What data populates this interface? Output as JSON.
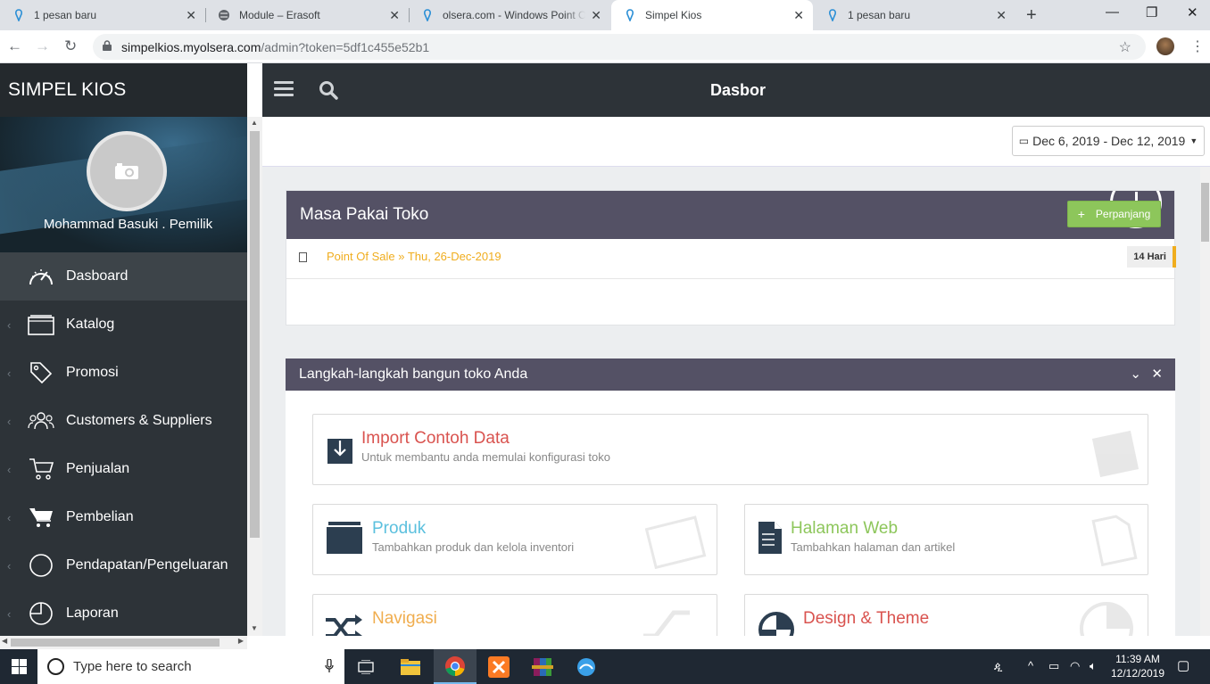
{
  "browser": {
    "tabs": [
      {
        "title": "1 pesan baru",
        "icon": "olsera-pin-icon"
      },
      {
        "title": "Module – Erasoft",
        "icon": "globe-icon"
      },
      {
        "title": "olsera.com - Windows Point Of Sale",
        "icon": "olsera-pin-icon"
      },
      {
        "title": "Simpel Kios",
        "icon": "olsera-pin-icon",
        "active": true
      },
      {
        "title": "1 pesan baru",
        "icon": "olsera-pin-icon"
      }
    ],
    "url_host": "simpelkios.myolsera.com",
    "url_path": "/admin?token=5df1c455e52b1"
  },
  "sidebar": {
    "brand": "SIMPEL KIOS",
    "user": "Mohammad Basuki . Pemilik",
    "items": [
      {
        "label": "Dasboard",
        "icon": "speedometer-icon"
      },
      {
        "label": "Katalog",
        "icon": "folder-icon"
      },
      {
        "label": "Promosi",
        "icon": "tag-icon"
      },
      {
        "label": "Customers & Suppliers",
        "icon": "users-icon"
      },
      {
        "label": "Penjualan",
        "icon": "cart-outline-icon"
      },
      {
        "label": "Pembelian",
        "icon": "cart-filled-icon"
      },
      {
        "label": "Pendapatan/Pengeluaran",
        "icon": "circle-icon"
      },
      {
        "label": "Laporan",
        "icon": "pie-chart-icon"
      }
    ]
  },
  "topnav": {
    "title": "Dasbor"
  },
  "daterange": {
    "label": "Dec 6, 2019 - Dec 12, 2019"
  },
  "subscription": {
    "title": "Masa Pakai Toko",
    "item_text": "Point Of Sale » Thu, 26-Dec-2019",
    "badge": "14 Hari",
    "renew_label": "Perpanjang"
  },
  "steps": {
    "title": "Langkah-langkah bangun toko Anda",
    "cards": [
      {
        "title": "Import Contoh Data",
        "subtitle": "Untuk membantu anda memulai konfigurasi toko",
        "color": "#d9534f"
      },
      {
        "title": "Produk",
        "subtitle": "Tambahkan produk dan kelola inventori",
        "color": "#5bc0de"
      },
      {
        "title": "Halaman Web",
        "subtitle": "Tambahkan halaman dan artikel",
        "color": "#8dc65b"
      },
      {
        "title": "Navigasi",
        "subtitle": "",
        "color": "#f0ad4e"
      },
      {
        "title": "Design & Theme",
        "subtitle": "",
        "color": "#d9534f"
      }
    ]
  },
  "taskbar": {
    "search_placeholder": "Type here to search",
    "time": "11:39 AM",
    "date": "12/12/2019"
  }
}
